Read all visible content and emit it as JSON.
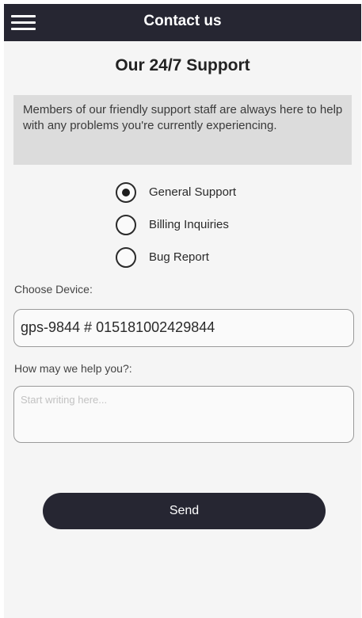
{
  "header": {
    "title": "Contact us",
    "menu_icon": "hamburger-menu-icon",
    "background_color": "#262632"
  },
  "page": {
    "heading": "Our 24/7 Support",
    "intro": "Members of our friendly support staff are always here to help with any problems you're currently experiencing."
  },
  "support_types": {
    "selected": "General Support",
    "options": [
      "General Support",
      "Billing Inquiries",
      "Bug Report"
    ]
  },
  "device": {
    "label": "Choose Device:",
    "selected_value": "gps-9844 # 015181002429844"
  },
  "message": {
    "label": "How may we help you?:",
    "placeholder": "Start writing here...",
    "value": ""
  },
  "actions": {
    "send_label": "Send",
    "button_color": "#262632"
  }
}
